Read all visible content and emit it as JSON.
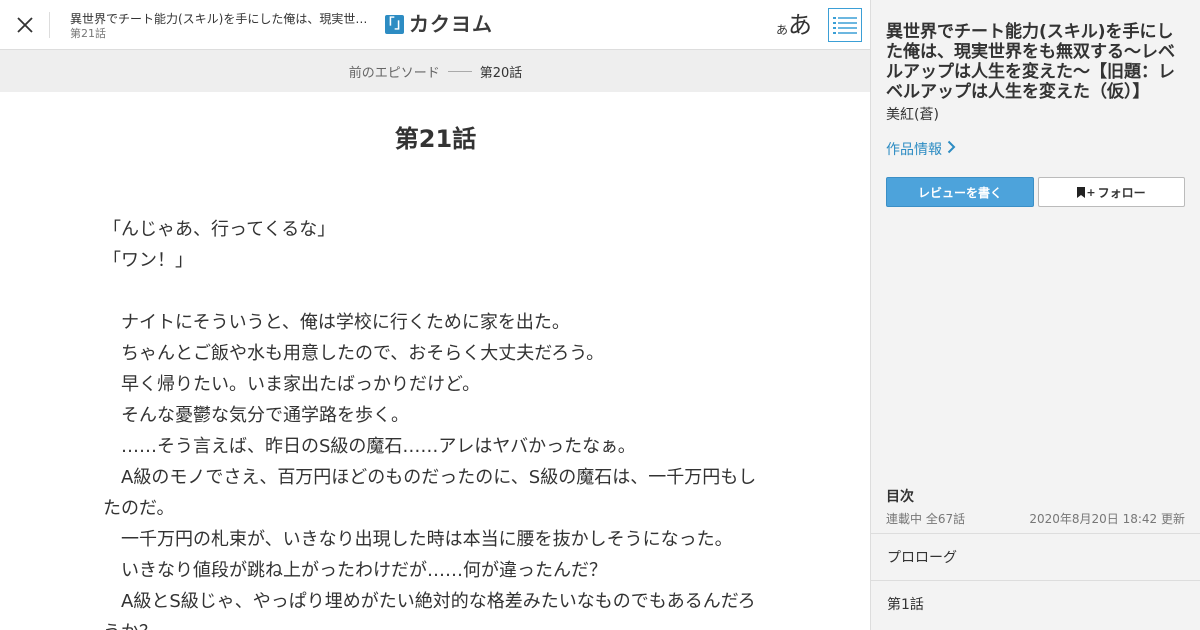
{
  "header": {
    "work_title": "異世界でチート能力(スキル)を手にした俺は、現実世界をも無双する～レベルアップは人生を変えた～",
    "episode_label": "第21話",
    "logo_mark": "「」",
    "logo_text": "カクヨム",
    "font_size_small": "あ",
    "font_size_large": "あ"
  },
  "prev_episode": {
    "label": "前のエピソード",
    "title": "第20話"
  },
  "episode": {
    "title": "第21話",
    "paragraphs": [
      "「んじゃあ、行ってくるな」",
      "「ワン！」",
      "",
      "　ナイトにそういうと、俺は学校に行くために家を出た。",
      "　ちゃんとご飯や水も用意したので、おそらく大丈夫だろう。",
      "　早く帰りたい。いま家出たばっかりだけど。",
      "　そんな憂鬱な気分で通学路を歩く。",
      "　……そう言えば、昨日のS級の魔石……アレはヤバかったなぁ。",
      "　A級のモノでさえ、百万円ほどのものだったのに、S級の魔石は、一千万円もしたのだ。",
      "　一千万円の札束が、いきなり出現した時は本当に腰を抜かしそうになった。",
      "　いきなり値段が跳ね上がったわけだが……何が違ったんだ？",
      "　A級とS級じゃ、やっぱり埋めがたい絶対的な格差みたいなものでもあるんだろうか？"
    ]
  },
  "sidebar": {
    "title": "異世界でチート能力(スキル)を手にした俺は、現実世界をも無双する～レベルアップは人生を変えた～【旧題：レベルアップは人生を変えた（仮）】",
    "author": "美紅(蒼)",
    "info_link": "作品情報",
    "review_button": "レビューを書く",
    "follow_button": "フォロー",
    "follow_plus": "+",
    "toc": {
      "heading": "目次",
      "status": "連載中 全67話",
      "updated": "2020年8月20日 18:42 更新",
      "items": [
        "プロローグ",
        "第1話"
      ]
    }
  },
  "colors": {
    "accent": "#2d8cc3",
    "button_primary": "#4da3db",
    "prev_bar_bg": "#eeeeee",
    "sidebar_bg": "#f3f3f3"
  }
}
